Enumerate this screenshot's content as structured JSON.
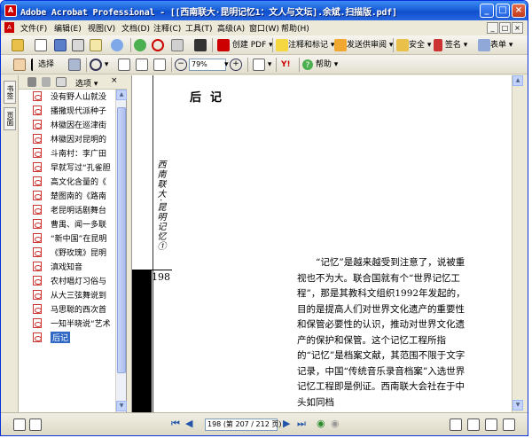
{
  "window": {
    "title": "Adobe Acrobat Professional - [[西南联大·昆明记忆1：文人与文坛].余斌.扫描版.pdf]",
    "min_glyph": "_",
    "max_glyph": "□",
    "close_glyph": "×"
  },
  "menu": [
    "文件(F)",
    "编辑(E)",
    "视图(V)",
    "文档(D)",
    "注释(C)",
    "工具(T)",
    "高级(A)",
    "窗口(W)",
    "帮助(H)"
  ],
  "toolbar1": {
    "create_pdf": "创建 PDF",
    "comment": "注释和标记",
    "send_review": "发送供审阅",
    "secure": "安全",
    "sign": "签名",
    "forms": "表单"
  },
  "toolbar2": {
    "select": "选择",
    "zoom": "79%",
    "help": "帮助"
  },
  "nav": {
    "tab_bookmarks": "书签",
    "tab_pages": "页面",
    "options": "选项",
    "bookmarks": [
      "没有野人山就没",
      "播撒现代派种子",
      "林徽因在巡津街",
      "林徽因对昆明的",
      "斗南村：李广田",
      "早就写过“孔雀胆",
      "高文化含量的《",
      "楚图南的《路南",
      "老昆明话剧舞台",
      "曹禺、闻一多联",
      "“新中国”在昆明",
      "《野玫瑰》昆明",
      "滇戏知音",
      "农村唱灯习俗与",
      "从大三弦舞说到",
      "马思聪的西次首",
      "一知半晓说“艺术",
      "后记"
    ],
    "selected_index": 17
  },
  "document": {
    "vertical_heading": "西南联大·昆明记忆①",
    "page_number": "198",
    "chapter_title": "后记",
    "paragraph": "“记忆”是越来越受到注意了，说被重视也不为大。联合国就有个“世界记忆工程”，那是其教科文组织1992年发起的，目的是提高人们对世界文化遗产的重要性和保管必要性的认识，推动对世界文化遗产的保护和保管。这个记忆工程所指的“记忆”是档案文献，其范围不限于文字记录，中国“传统音乐录音档案”入选世界记忆工程即是例证。西南联大会社在于中头如同档"
  },
  "status": {
    "page_field": "198 (第 207 / 212 页)"
  },
  "colors": {
    "titlebar": "#1a5fd8",
    "selection": "#316ac5",
    "acrobat_red": "#cc0000"
  }
}
